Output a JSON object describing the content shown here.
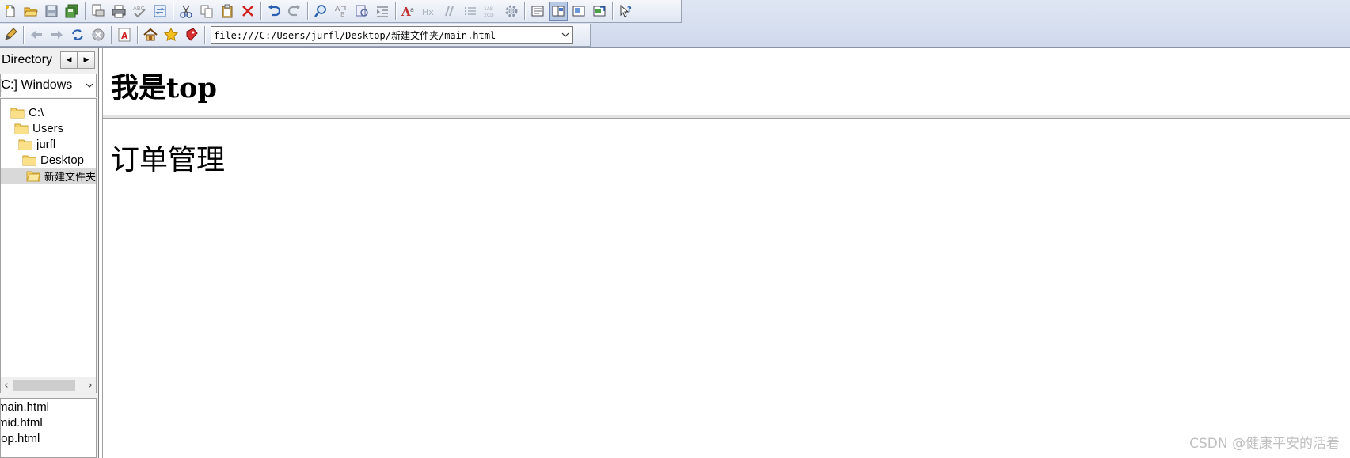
{
  "toolbar": {
    "row1_icons": [
      "new-file-icon",
      "open-folder-icon",
      "save-icon",
      "save-all-icon",
      "print-preview-icon",
      "print-icon",
      "spell-check-icon",
      "convert-icon",
      "cut-icon",
      "copy-icon",
      "paste-icon",
      "delete-icon",
      "undo-icon",
      "redo-icon",
      "find-icon",
      "replace-icon",
      "find-in-files-icon",
      "indent-icon",
      "font-size-icon",
      "heading-icon",
      "italic-format-icon",
      "list-icon",
      "numbered-list-icon",
      "settings-gear-icon",
      "view-code-icon",
      "view-split-icon",
      "view-preview-icon",
      "external-browser-icon",
      "help-cursor-icon"
    ],
    "row2_icons": [
      "edit-pencil-icon",
      "back-arrow-icon",
      "forward-arrow-icon",
      "refresh-icon",
      "stop-icon",
      "pdf-icon",
      "home-icon",
      "favorites-star-icon",
      "bookmark-icon"
    ],
    "url": "file:///C:/Users/jurfl/Desktop/新建文件夹/main.html"
  },
  "left_panel": {
    "title": "Directory",
    "drive": "[C:] Windows",
    "tree": [
      {
        "label": "C:\\",
        "level": 0,
        "selected": false
      },
      {
        "label": "Users",
        "level": 1,
        "selected": false
      },
      {
        "label": "jurfl",
        "level": 2,
        "selected": false
      },
      {
        "label": "Desktop",
        "level": 3,
        "selected": false
      },
      {
        "label": "新建文件夹",
        "level": 4,
        "selected": true
      }
    ],
    "files": [
      "main.html",
      "mid.html",
      "top.html"
    ]
  },
  "content": {
    "top_heading": "我是top",
    "main_heading": "订单管理"
  },
  "watermark": "CSDN @健康平安的活着"
}
